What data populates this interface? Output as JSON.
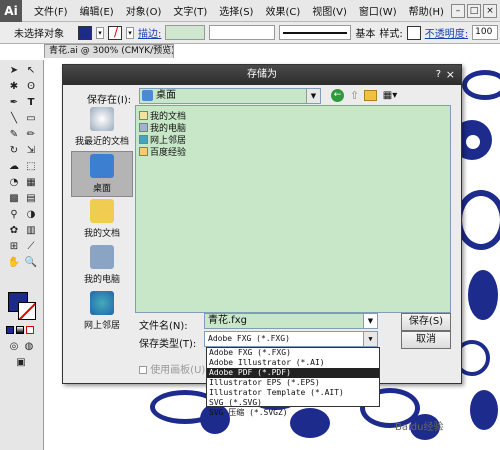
{
  "app": {
    "logo": "Ai"
  },
  "menubar": {
    "items": [
      "文件(F)",
      "编辑(E)",
      "对象(O)",
      "文字(T)",
      "选择(S)",
      "效果(C)",
      "视图(V)",
      "窗口(W)",
      "帮助(H)"
    ],
    "win_controls": [
      "–",
      "□",
      "×"
    ]
  },
  "controlbar": {
    "status": "未选择对象",
    "stroke_label": "描边:",
    "brush_label": "基本",
    "style_label": "样式:",
    "opacity_label": "不透明度:",
    "opacity_value": "100"
  },
  "doc": {
    "tab_title": "青花.ai @ 300% (CMYK/预览)"
  },
  "dialog": {
    "title": "存储为",
    "help": "?",
    "close": "×",
    "save_in_label": "保存在(I):",
    "save_in_value": "桌面",
    "places": [
      "我最近的文档",
      "桌面",
      "我的文档",
      "我的电脑",
      "网上邻居"
    ],
    "files": [
      "我的文档",
      "我的电脑",
      "网上邻居",
      "百度经验"
    ],
    "filename_label": "文件名(N):",
    "filename_value": "青花.fxg",
    "filetype_label": "保存类型(T):",
    "filetype_value": "Adobe FXG (*.FXG)",
    "save_button": "保存(S)",
    "cancel_button": "取消",
    "artboard_label": "使用画板(U)",
    "type_options": [
      "Adobe FXG (*.FXG)",
      "Adobe Illustrator (*.AI)",
      "Adobe PDF (*.PDF)",
      "Illustrator EPS (*.EPS)",
      "Illustrator Template (*.AIT)",
      "SVG (*.SVG)",
      "SVG 压缩 (*.SVGZ)"
    ],
    "selected_type_index": 2
  },
  "colors": {
    "fill": "#1c2a8a",
    "list_bg": "#c8e6c8",
    "art_blue": "#1d2b8c"
  },
  "watermark": "Baidu经验"
}
